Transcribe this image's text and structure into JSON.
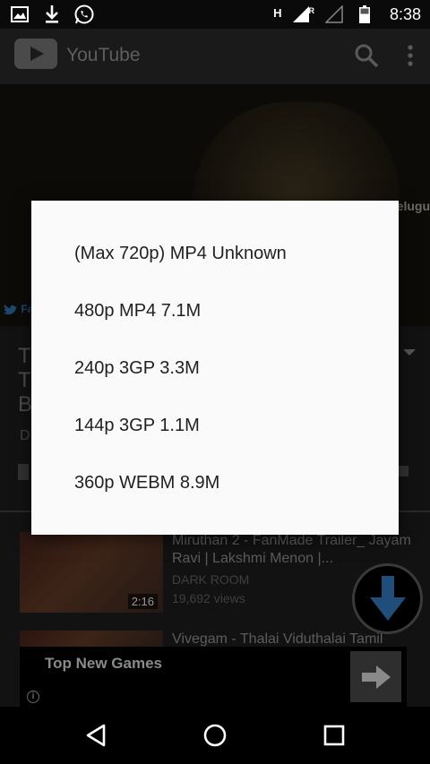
{
  "status_bar": {
    "time": "8:38",
    "network_h": "H",
    "network_r": "R",
    "left_icons": [
      "gallery-icon",
      "download-icon",
      "whatsapp-icon"
    ],
    "right_icons": [
      "signal-icon",
      "signal-roaming-icon",
      "signal-empty-icon",
      "battery-icon"
    ]
  },
  "app_bar": {
    "title": "YouTube",
    "icons": [
      "youtube-logo-icon",
      "search-icon",
      "more-vert-icon"
    ]
  },
  "video": {
    "overlay_text": "Telugu",
    "twitter_text": "Fa"
  },
  "info": {
    "title_fragment": [
      "T",
      "T",
      "B"
    ],
    "meta_fragment": "D"
  },
  "related": [
    {
      "title": "Miruthan 2 - FanMade Trailer_ Jayam Ravi | Lakshmi Menon |...",
      "channel": "DARK ROOM",
      "views": "19,692 views",
      "duration": "2:16"
    },
    {
      "title": "Vivegam - Thalai Viduthalai Tamil"
    }
  ],
  "ad": {
    "title": "Top New Games",
    "info_glyph": "i"
  },
  "dialog": {
    "options": [
      "(Max 720p) MP4 Unknown",
      "480p MP4 7.1M",
      "240p 3GP 3.3M",
      "144p 3GP 1.1M",
      "360p WEBM 8.9M"
    ]
  },
  "nav_bar": {
    "icons": [
      "back-icon",
      "home-icon",
      "recents-icon"
    ]
  },
  "colors": {
    "dialog_bg": "#fafafa",
    "dialog_text": "#212121",
    "app_bar_bg": "#1a1a1a",
    "status_bar_bg": "#0a0a0a"
  }
}
